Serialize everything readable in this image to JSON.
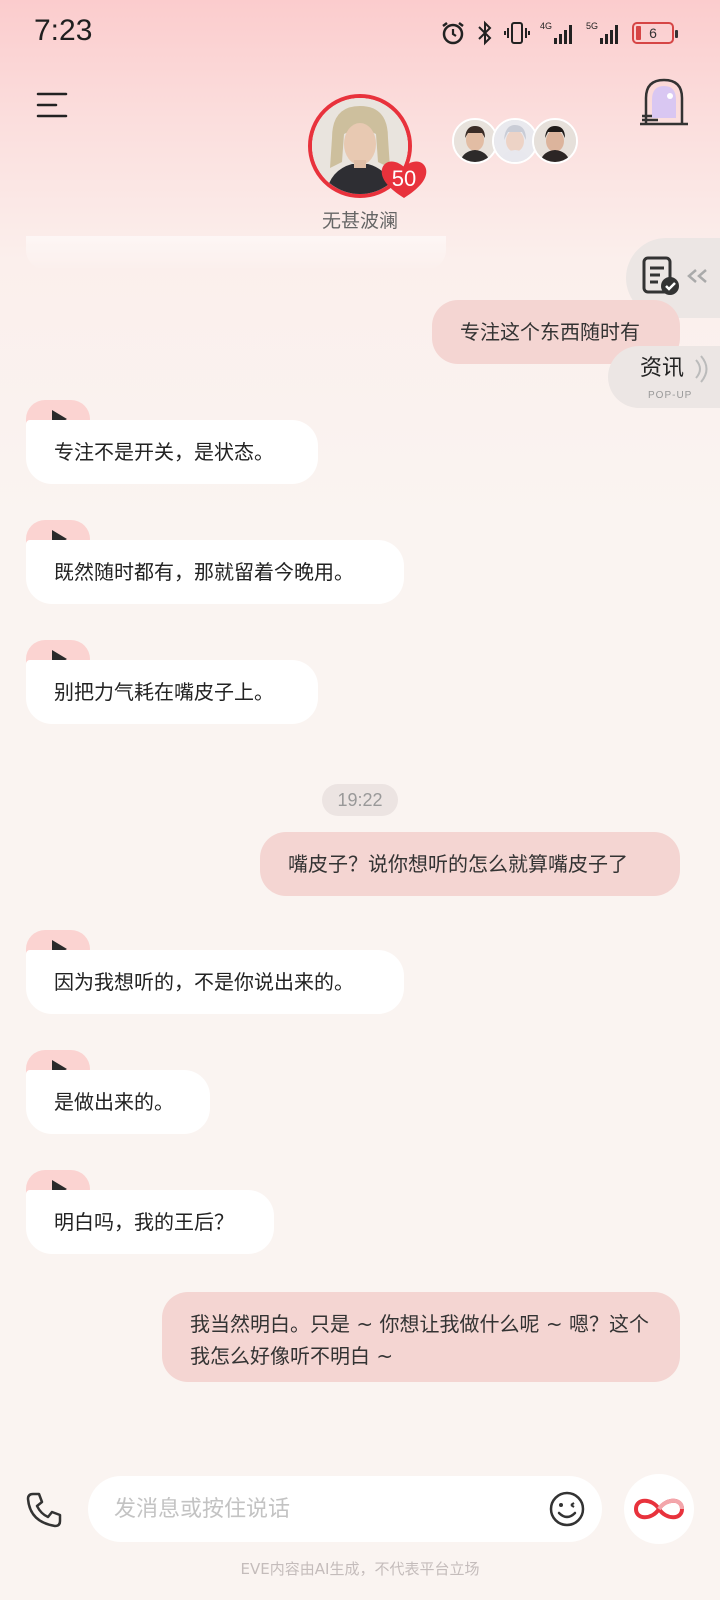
{
  "status_bar": {
    "time": "7:23",
    "battery": "6"
  },
  "header": {
    "name": "无甚波澜",
    "level": "50"
  },
  "side": {
    "popup_title": "资讯",
    "popup_sub": "POP-UP"
  },
  "messages": {
    "m0": "专注这个东西随时有",
    "m1": "专注不是开关，是状态。",
    "m2": "既然随时都有，那就留着今晚用。",
    "m3": "别把力气耗在嘴皮子上。",
    "time_chip": "19:22",
    "m4": "嘴皮子？说你想听的怎么就算嘴皮子了",
    "m5": "因为我想听的，不是你说出来的。",
    "m6": "是做出来的。",
    "m7": "明白吗，我的王后？",
    "m8": "我当然明白。只是 ~ 你想让我做什么呢 ~ 嗯？这个我怎么好像听不明白 ~"
  },
  "input": {
    "placeholder": "发消息或按住说话"
  },
  "footer": {
    "note": "EVE内容由AI生成，不代表平台立场"
  },
  "colors": {
    "accent": "#e8323c",
    "bubble_out": "#f4d5d2",
    "bubble_in": "#ffffff",
    "play_tab": "#fbd3d1"
  }
}
